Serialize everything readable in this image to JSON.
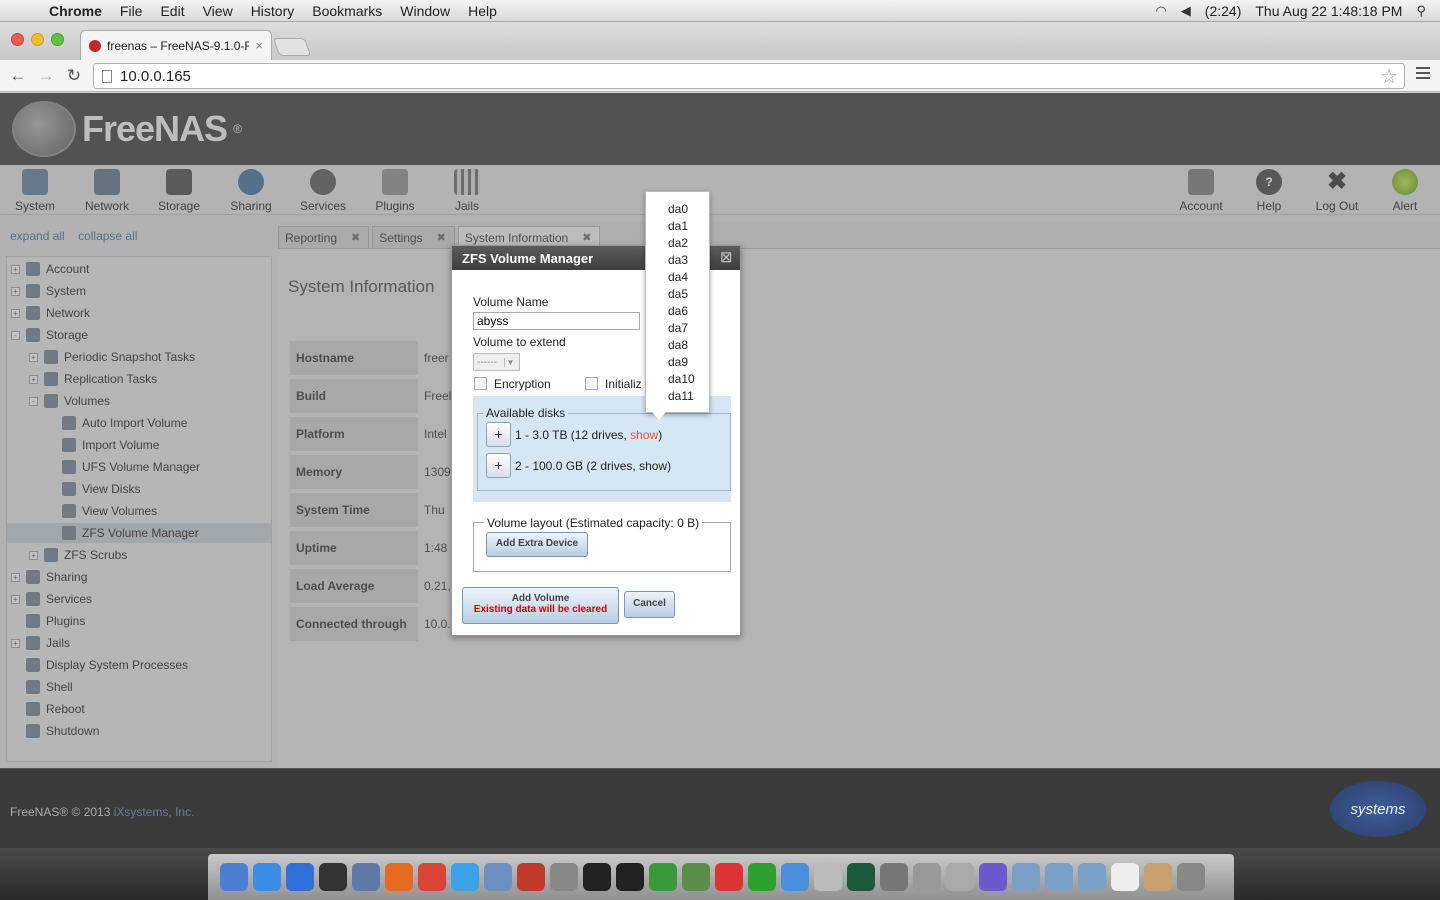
{
  "menubar": {
    "app": "Chrome",
    "items": [
      "File",
      "Edit",
      "View",
      "History",
      "Bookmarks",
      "Window",
      "Help"
    ],
    "battery": "(2:24)",
    "datetime": "Thu Aug 22  1:48:18 PM"
  },
  "browser": {
    "tab_title": "freenas – FreeNAS-9.1.0-R",
    "url": "10.0.0.165"
  },
  "header": {
    "brand": "FreeNAS"
  },
  "topnav": {
    "left": [
      {
        "label": "System",
        "icon": "system-icon"
      },
      {
        "label": "Network",
        "icon": "network-icon"
      },
      {
        "label": "Storage",
        "icon": "storage-icon"
      },
      {
        "label": "Sharing",
        "icon": "sharing-icon"
      },
      {
        "label": "Services",
        "icon": "services-icon"
      },
      {
        "label": "Plugins",
        "icon": "plugins-icon"
      },
      {
        "label": "Jails",
        "icon": "jails-icon"
      }
    ],
    "right": [
      {
        "label": "Account",
        "icon": "account-icon"
      },
      {
        "label": "Help",
        "icon": "help-icon"
      },
      {
        "label": "Log Out",
        "icon": "logout-icon"
      },
      {
        "label": "Alert",
        "icon": "alert-icon"
      }
    ]
  },
  "tree_links": {
    "expand": "expand all",
    "collapse": "collapse all"
  },
  "tree": [
    {
      "label": "Account",
      "level": 0,
      "exp": "+"
    },
    {
      "label": "System",
      "level": 0,
      "exp": "+"
    },
    {
      "label": "Network",
      "level": 0,
      "exp": "+"
    },
    {
      "label": "Storage",
      "level": 0,
      "exp": "-"
    },
    {
      "label": "Periodic Snapshot Tasks",
      "level": 1,
      "exp": "+"
    },
    {
      "label": "Replication Tasks",
      "level": 1,
      "exp": "+"
    },
    {
      "label": "Volumes",
      "level": 1,
      "exp": "-"
    },
    {
      "label": "Auto Import Volume",
      "level": 2,
      "exp": ""
    },
    {
      "label": "Import Volume",
      "level": 2,
      "exp": ""
    },
    {
      "label": "UFS Volume Manager",
      "level": 2,
      "exp": ""
    },
    {
      "label": "View Disks",
      "level": 2,
      "exp": ""
    },
    {
      "label": "View Volumes",
      "level": 2,
      "exp": ""
    },
    {
      "label": "ZFS Volume Manager",
      "level": 2,
      "exp": "",
      "selected": true
    },
    {
      "label": "ZFS Scrubs",
      "level": 1,
      "exp": "+"
    },
    {
      "label": "Sharing",
      "level": 0,
      "exp": "+"
    },
    {
      "label": "Services",
      "level": 0,
      "exp": "+"
    },
    {
      "label": "Plugins",
      "level": 0,
      "exp": ""
    },
    {
      "label": "Jails",
      "level": 0,
      "exp": "+"
    },
    {
      "label": "Display System Processes",
      "level": 0,
      "exp": ""
    },
    {
      "label": "Shell",
      "level": 0,
      "exp": ""
    },
    {
      "label": "Reboot",
      "level": 0,
      "exp": ""
    },
    {
      "label": "Shutdown",
      "level": 0,
      "exp": ""
    }
  ],
  "content_tabs": [
    "Reporting",
    "Settings",
    "System Information"
  ],
  "sysinfo": {
    "title": "System Information",
    "rows": [
      {
        "key": "Hostname",
        "value": "freer"
      },
      {
        "key": "Build",
        "value": "Freel"
      },
      {
        "key": "Platform",
        "value": "Intel"
      },
      {
        "key": "Memory",
        "value": "1309"
      },
      {
        "key": "System Time",
        "value": "Thu"
      },
      {
        "key": "Uptime",
        "value": "1:48"
      },
      {
        "key": "Load Average",
        "value": "0.21,"
      },
      {
        "key": "Connected through",
        "value": "10.0."
      }
    ]
  },
  "dialog": {
    "title": "ZFS Volume Manager",
    "close": "☒",
    "volume_name_label": "Volume Name",
    "volume_name_value": "abyss",
    "volume_extend_label": "Volume to extend",
    "volume_extend_value": "------",
    "encryption_label": "Encryption",
    "initialize_label": "Initializ",
    "available_disks_legend": "Available disks",
    "groups": [
      {
        "plus": "+",
        "text": "1 - 3.0 TB (12 drives, ",
        "show": "show",
        "close": ")"
      },
      {
        "plus": "+",
        "text": "2 - 100.0 GB (2 drives, ",
        "show": "show",
        "close": ")"
      }
    ],
    "layout_legend": "Volume layout (Estimated capacity: 0 B)",
    "add_extra_device": "Add Extra Device",
    "add_volume": "Add Volume",
    "add_volume_warning": "Existing data will be cleared",
    "cancel": "Cancel"
  },
  "disk_list": [
    "da0",
    "da1",
    "da2",
    "da3",
    "da4",
    "da5",
    "da6",
    "da7",
    "da8",
    "da9",
    "da10",
    "da11"
  ],
  "footer": {
    "copyright": "FreeNAS® © 2013 ",
    "company": "iXsystems, Inc.",
    "logo_text": "systems"
  }
}
